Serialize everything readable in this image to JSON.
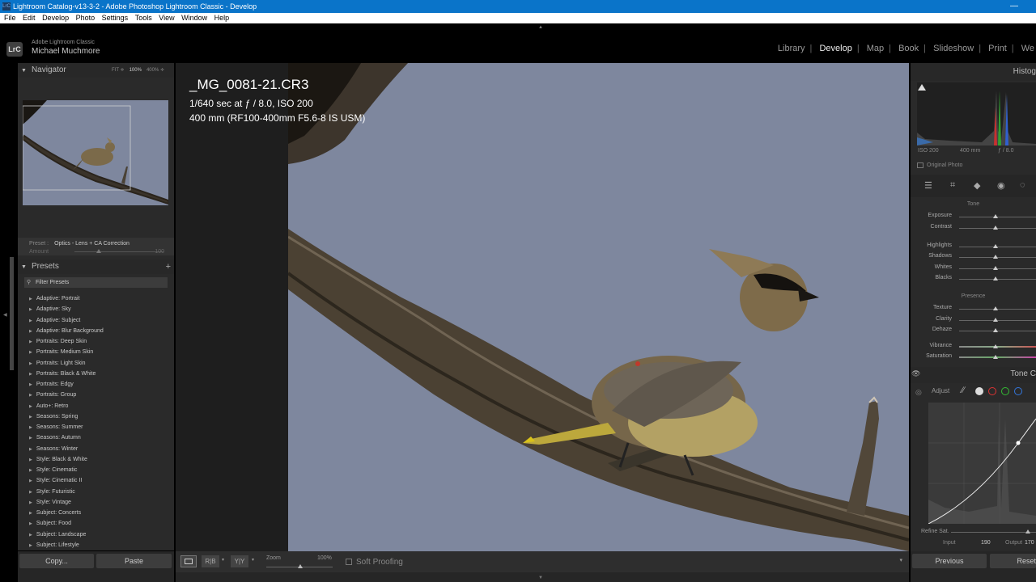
{
  "window": {
    "title": "Lightroom Catalog-v13-3-2 - Adobe Photoshop Lightroom Classic - Develop",
    "icon": "LrC",
    "minimize_glyph": "—"
  },
  "menu": [
    "File",
    "Edit",
    "Develop",
    "Photo",
    "Settings",
    "Tools",
    "View",
    "Window",
    "Help"
  ],
  "identity": {
    "logo": "LrC",
    "app_name": "Adobe Lightroom Classic",
    "user": "Michael Muchmore"
  },
  "modules": {
    "items": [
      "Library",
      "Develop",
      "Map",
      "Book",
      "Slideshow",
      "Print",
      "We"
    ],
    "separator": "|",
    "active": "Develop"
  },
  "navigator": {
    "title": "Navigator",
    "zoom_fit": "FIT ≑",
    "zoom_100": "100%",
    "zoom_400": "400% ≑"
  },
  "preset_amount": {
    "preset_label": "Preset",
    "preset_value": "Optics - Lens + CA Correction",
    "amount_label": "Amount",
    "amount_value": "100"
  },
  "presets": {
    "title": "Presets",
    "add_glyph": "+",
    "filter_placeholder": "Filter Presets",
    "items": [
      "Adaptive: Portrait",
      "Adaptive: Sky",
      "Adaptive: Subject",
      "Adaptive: Blur Background",
      "Portraits: Deep Skin",
      "Portraits: Medium Skin",
      "Portraits: Light Skin",
      "Portraits: Black & White",
      "Portraits: Edgy",
      "Portraits: Group",
      "Auto+: Retro",
      "Seasons: Spring",
      "Seasons: Summer",
      "Seasons: Autumn",
      "Seasons: Winter",
      "Style: Black & White",
      "Style: Cinematic",
      "Style: Cinematic II",
      "Style: Futuristic",
      "Style: Vintage",
      "Subject: Concerts",
      "Subject: Food",
      "Subject: Landscape",
      "Subject: Lifestyle"
    ]
  },
  "left_buttons": {
    "copy": "Copy...",
    "paste": "Paste"
  },
  "photo_info": {
    "filename": "_MG_0081-21.CR3",
    "exposure": "1/640 sec at ƒ / 8.0, ISO 200",
    "lens": "400 mm (RF100-400mm F5.6-8 IS USM)"
  },
  "toolbar": {
    "zoom_label": "Zoom",
    "zoom_value": "100%",
    "soft_proofing": "Soft Proofing",
    "compare_rb": "R|B",
    "compare_yy": "Y|Y"
  },
  "histogram": {
    "title": "Histog",
    "iso": "ISO 200",
    "focal": "400 mm",
    "aperture": "ƒ / 8.0",
    "original_photo": "Original Photo"
  },
  "basic": {
    "tone_group": "Tone",
    "tone_sliders": [
      "Exposure",
      "Contrast"
    ],
    "tone_sliders2": [
      "Highlights",
      "Shadows",
      "Whites",
      "Blacks"
    ],
    "presence_group": "Presence",
    "presence_sliders": [
      "Texture",
      "Clarity",
      "Dehaze"
    ],
    "color_sliders": [
      "Vibrance",
      "Saturation"
    ]
  },
  "tone_curve": {
    "title": "Tone C",
    "adjust": "Adjust",
    "refine_sat": "Refine Sat.",
    "input_label": "Input",
    "input_value": "190",
    "output_label": "Output",
    "output_value": "170"
  },
  "right_buttons": {
    "previous": "Previous",
    "reset": "Reset"
  },
  "colors": {
    "titlebar": "#0a74c9",
    "sky": "#7e879e",
    "panel": "#2a2a2a"
  }
}
